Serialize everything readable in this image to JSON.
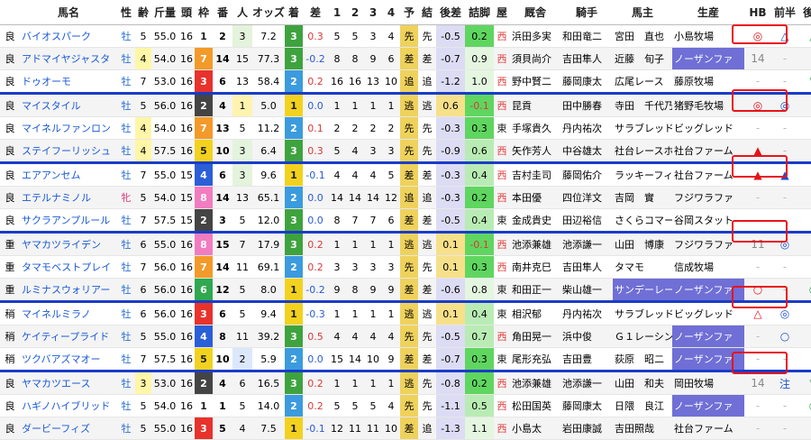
{
  "headers": [
    "",
    "馬名",
    "性",
    "齢",
    "斤量",
    "頭",
    "枠",
    "番",
    "人",
    "オッズ",
    "着",
    "差",
    "1",
    "2",
    "3",
    "4",
    "予",
    "結",
    "後差",
    "詰脚",
    "屋",
    "厩舎",
    "騎手",
    "馬主",
    "生産",
    "HB",
    "前半",
    "後半"
  ],
  "colors": {
    "waku": {
      "1": "#ffffff",
      "2": "#444444",
      "3": "#e8322c",
      "4": "#2a5fd8",
      "5": "#f2d21e",
      "6": "#2fa84f",
      "7": "#f39a2a",
      "8": "#f27cc0"
    },
    "chaku": {
      "1": "#f2d21e",
      "2": "#3b9bde",
      "3": "#3ea33e"
    },
    "sep": "#1a3cc8",
    "redbox": "#e8141a"
  },
  "rows": [
    [
      "良",
      "バイオスパーク",
      "牡",
      "5",
      "55.0",
      "16",
      "1",
      "2",
      "3",
      "7.2",
      "3",
      "0.3",
      "5",
      "5",
      "3",
      "4",
      "先",
      "先",
      "-0.5",
      "0.2",
      "西",
      "浜田多実",
      "和田竜二",
      "宮田　直也",
      "小島牧場",
      "◎",
      "△",
      "△"
    ],
    [
      "良",
      "アドマイヤジャスタ",
      "牡",
      "4",
      "54.0",
      "16",
      "7",
      "14",
      "15",
      "77.3",
      "3",
      "-0.2",
      "8",
      "8",
      "9",
      "6",
      "差",
      "差",
      "-0.7",
      "0.9",
      "西",
      "須貝尚介",
      "吉田隼人",
      "近藤　旬子",
      "ノーザンファ",
      "14",
      "-",
      "-"
    ],
    [
      "良",
      "ドゥオーモ",
      "牡",
      "7",
      "53.0",
      "16",
      "3",
      "6",
      "13",
      "58.4",
      "2",
      "0.2",
      "16",
      "16",
      "13",
      "10",
      "追",
      "追",
      "-1.2",
      "1.0",
      "西",
      "野中賢二",
      "藤岡康太",
      "広尾レース",
      "藤原牧場",
      "-",
      "-",
      "▽"
    ],
    [
      "良",
      "マイスタイル",
      "牡",
      "5",
      "56.0",
      "16",
      "2",
      "4",
      "1",
      "5.0",
      "1",
      "0.0",
      "1",
      "1",
      "1",
      "1",
      "逃",
      "逃",
      "0.6",
      "-0.1",
      "西",
      "昆貢",
      "田中勝春",
      "寺田　千代乃",
      "猪野毛牧場",
      "◎",
      "◎",
      "-"
    ],
    [
      "良",
      "マイネルファンロン",
      "牡",
      "4",
      "54.0",
      "16",
      "7",
      "13",
      "5",
      "11.2",
      "2",
      "0.1",
      "2",
      "2",
      "2",
      "2",
      "先",
      "先",
      "-0.3",
      "0.3",
      "東",
      "手塚貴久",
      "丹内祐次",
      "サラブレッド",
      "ビッグレッド",
      "-",
      "-",
      "-"
    ],
    [
      "良",
      "ステイフーリッシュ",
      "牡",
      "4",
      "57.5",
      "16",
      "5",
      "10",
      "3",
      "6.4",
      "3",
      "0.3",
      "5",
      "4",
      "3",
      "3",
      "先",
      "先",
      "-0.9",
      "0.6",
      "西",
      "矢作芳人",
      "中谷雄太",
      "社台レースホ",
      "社台ファーム",
      "▲",
      "-",
      "-"
    ],
    [
      "良",
      "エアアンセム",
      "牡",
      "7",
      "55.0",
      "15",
      "4",
      "6",
      "3",
      "9.6",
      "1",
      "-0.1",
      "4",
      "4",
      "4",
      "5",
      "差",
      "差",
      "-0.3",
      "0.4",
      "西",
      "吉村圭司",
      "藤岡佑介",
      "ラッキーフィ",
      "社台ファーム",
      "▲",
      "▲",
      "-"
    ],
    [
      "良",
      "エテルナミノル",
      "牝",
      "5",
      "54.0",
      "15",
      "8",
      "14",
      "13",
      "65.1",
      "2",
      "0.0",
      "14",
      "14",
      "14",
      "12",
      "追",
      "追",
      "-0.3",
      "0.2",
      "西",
      "本田優",
      "四位洋文",
      "吉岡　實",
      "フジワラファ",
      "-",
      "-",
      "-"
    ],
    [
      "良",
      "サクラアンプルール",
      "牡",
      "7",
      "57.5",
      "15",
      "2",
      "3",
      "5",
      "12.0",
      "3",
      "0.0",
      "8",
      "7",
      "7",
      "6",
      "差",
      "差",
      "-0.5",
      "0.4",
      "東",
      "金成貴史",
      "田辺裕信",
      "さくらコマー",
      "谷岡スタット",
      "-",
      "-",
      "-"
    ],
    [
      "重",
      "ヤマカツライデン",
      "牡",
      "6",
      "55.0",
      "16",
      "8",
      "15",
      "7",
      "17.9",
      "3",
      "0.2",
      "1",
      "1",
      "1",
      "1",
      "逃",
      "逃",
      "0.1",
      "-0.1",
      "西",
      "池添兼雄",
      "池添謙一",
      "山田　博康",
      "フジワラファ",
      "11",
      "◎",
      "-"
    ],
    [
      "重",
      "タマモベストプレイ",
      "牡",
      "7",
      "56.0",
      "16",
      "7",
      "14",
      "11",
      "69.1",
      "2",
      "0.2",
      "3",
      "3",
      "3",
      "3",
      "先",
      "先",
      "0.1",
      "0.3",
      "西",
      "南井克巳",
      "吉田隼人",
      "タマモ",
      "信成牧場",
      "-",
      "-",
      "-"
    ],
    [
      "重",
      "ルミナスウォリアー",
      "牡",
      "6",
      "56.0",
      "16",
      "6",
      "12",
      "5",
      "8.0",
      "1",
      "-0.2",
      "9",
      "8",
      "9",
      "9",
      "差",
      "差",
      "-0.6",
      "0.8",
      "東",
      "和田正一",
      "柴山雄一",
      "サンデーレー",
      "ノーザンファ",
      "○",
      "-",
      "○"
    ],
    [
      "稍",
      "マイネルミラノ",
      "牡",
      "6",
      "56.0",
      "16",
      "3",
      "6",
      "5",
      "9.4",
      "1",
      "-0.3",
      "1",
      "1",
      "1",
      "1",
      "逃",
      "逃",
      "0.1",
      "0.4",
      "東",
      "相沢郁",
      "丹内祐次",
      "サラブレッド",
      "ビッグレッド",
      "△",
      "◎",
      "-"
    ],
    [
      "稍",
      "ケイティープライド",
      "牡",
      "5",
      "55.0",
      "16",
      "4",
      "8",
      "11",
      "39.2",
      "3",
      "0.5",
      "4",
      "4",
      "4",
      "4",
      "先",
      "先",
      "-0.5",
      "0.7",
      "西",
      "角田晃一",
      "浜中俊",
      "Ｇ１レーシン",
      "ノーザンファ",
      "-",
      "○",
      "-"
    ],
    [
      "稍",
      "ツクバアズマオー",
      "牡",
      "7",
      "57.5",
      "16",
      "5",
      "10",
      "2",
      "5.9",
      "2",
      "0.0",
      "15",
      "14",
      "10",
      "9",
      "差",
      "差",
      "-0.7",
      "0.3",
      "東",
      "尾形充弘",
      "吉田豊",
      "荻原　昭二",
      "ノーザンファ",
      "-",
      "-",
      "-"
    ],
    [
      "良",
      "ヤマカツエース",
      "牡",
      "3",
      "53.0",
      "16",
      "2",
      "4",
      "6",
      "16.5",
      "3",
      "0.2",
      "1",
      "1",
      "1",
      "1",
      "逃",
      "先",
      "-0.8",
      "0.2",
      "西",
      "池添兼雄",
      "池添謙一",
      "山田　和夫",
      "岡田牧場",
      "14",
      "注",
      "▽"
    ],
    [
      "良",
      "ハギノハイブリッド",
      "牡",
      "5",
      "54.0",
      "16",
      "1",
      "1",
      "5",
      "14.0",
      "2",
      "0.2",
      "5",
      "5",
      "5",
      "4",
      "先",
      "先",
      "-1.1",
      "0.5",
      "西",
      "松田国英",
      "藤岡康太",
      "日隈　良江",
      "ノーザンファ",
      "-",
      "-",
      "◎"
    ],
    [
      "良",
      "ダービーフィズ",
      "牡",
      "5",
      "55.0",
      "16",
      "3",
      "5",
      "4",
      "7.5",
      "1",
      "-0.1",
      "12",
      "11",
      "11",
      "10",
      "差",
      "追",
      "-1.3",
      "1.1",
      "西",
      "小島太",
      "岩田康誠",
      "吉田照哉",
      "社台ファーム",
      "-",
      "-",
      "-"
    ]
  ]
}
